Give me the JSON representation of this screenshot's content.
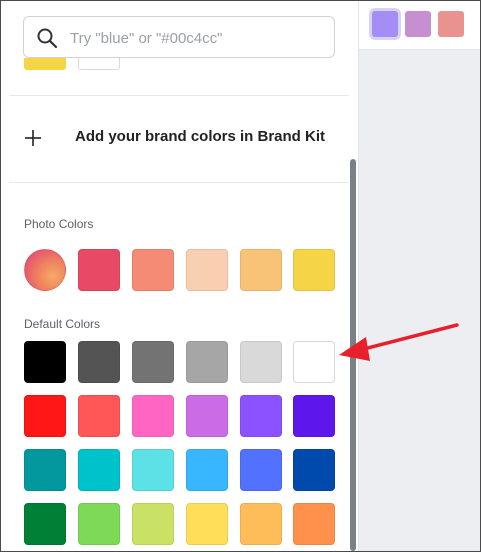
{
  "search": {
    "placeholder": "Try \"blue\" or \"#00c4cc\""
  },
  "brand": {
    "add_label": "Add your brand colors in Brand Kit"
  },
  "photo_colors": {
    "label": "Photo Colors",
    "swatches": [
      "photo-gradient",
      "#e84a65",
      "#f58b74",
      "#f8cfb1",
      "#f8c376",
      "#f5d545"
    ]
  },
  "default_colors": {
    "label": "Default Colors",
    "rows": [
      [
        "#000000",
        "#545454",
        "#737373",
        "#a6a6a6",
        "#d9d9d9",
        "#ffffff"
      ],
      [
        "#ff1616",
        "#ff5757",
        "#ff66c4",
        "#cb6ce6",
        "#8c52ff",
        "#5e17eb"
      ],
      [
        "#03989e",
        "#00c2cb",
        "#5ce1e6",
        "#38b6ff",
        "#5271ff",
        "#004aad"
      ],
      [
        "#008037",
        "#7ed957",
        "#c9e265",
        "#ffde59",
        "#ffbd59",
        "#ff914d"
      ]
    ]
  },
  "top_swatches": [
    "#a48ef5",
    "#c68fcf",
    "#e99391"
  ],
  "cut_swatches": [
    "#f5d545",
    "#ffffff"
  ],
  "annotation": {
    "arrow_color": "#e8202b"
  }
}
